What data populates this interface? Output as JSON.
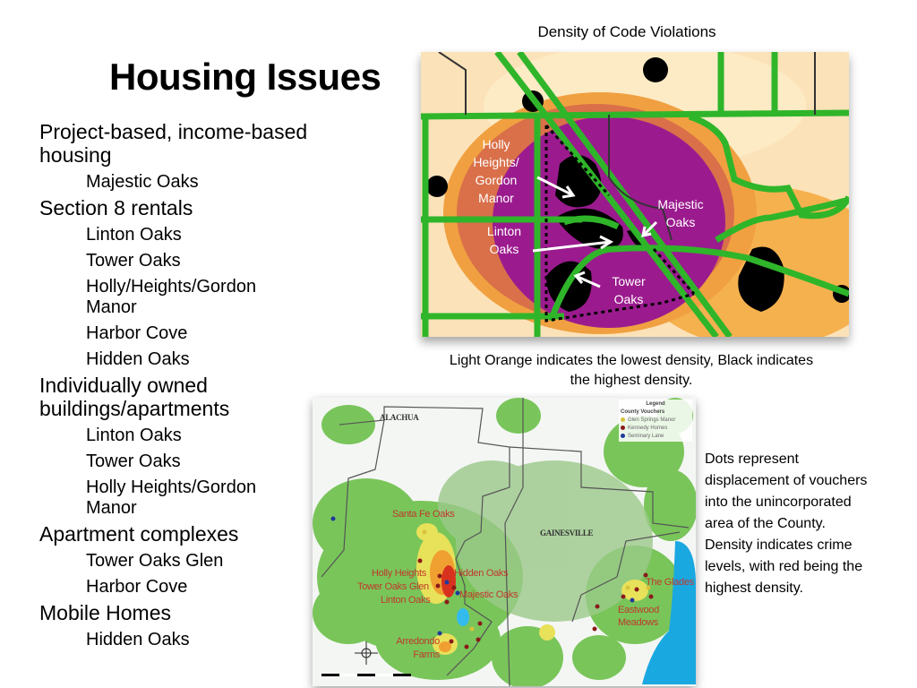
{
  "slide": {
    "title": "Housing Issues",
    "outline": [
      {
        "heading": "Project-based, income-based housing",
        "items": [
          "Majestic Oaks"
        ]
      },
      {
        "heading": "Section 8 rentals",
        "items": [
          "Linton Oaks",
          "Tower Oaks",
          "Holly/Heights/Gordon Manor",
          "Harbor Cove",
          "Hidden Oaks"
        ]
      },
      {
        "heading": "Individually owned buildings/apartments",
        "items": [
          "Linton Oaks",
          "Tower Oaks",
          "Holly Heights/Gordon Manor"
        ]
      },
      {
        "heading": "Apartment complexes",
        "items": [
          "Tower Oaks Glen",
          "Harbor Cove"
        ]
      },
      {
        "heading": "Mobile Homes",
        "items": [
          "Hidden Oaks"
        ]
      }
    ]
  },
  "map_code_violations": {
    "caption_title": "Density of Code Violations",
    "caption_note": "Light Orange indicates the lowest density, Black indicates the highest density.",
    "labels": {
      "holly": "Holly Heights/ Gordon Manor",
      "majestic": "Majestic Oaks",
      "linton": "Linton Oaks",
      "tower": "Tower Oaks"
    },
    "colors": {
      "low": "#fbd9a0",
      "mid": "#f4a742",
      "high": "#9b1b8e",
      "highest": "#000000",
      "roads": "#2fb52a"
    }
  },
  "map_vouchers": {
    "place_labels": {
      "alachua": "ALACHUA",
      "gainesville": "GAINESVILLE"
    },
    "site_labels": {
      "santa_fe": "Santa Fe Oaks",
      "holly": "Holly Heights",
      "hidden": "Hidden Oaks",
      "tower_glen": "Tower Oaks Glen",
      "majestic": "Majestic Oaks",
      "linton": "Linton Oaks",
      "arredondo": "Arredondo Farms",
      "glades": "The Glades",
      "eastwood": "Eastwood Meadows"
    },
    "legend": {
      "title": "Legend",
      "subtitle": "County Vouchers",
      "entries": [
        {
          "label": "Glen Springs Manor",
          "color": "#d8c23a"
        },
        {
          "label": "Kennedy Homes",
          "color": "#8b1a1a"
        },
        {
          "label": "Seminary Lane",
          "color": "#1f3a9a"
        }
      ]
    },
    "description": "Dots represent displacement of vouchers into the unincorporated area of the County. Density indicates crime levels, with red being the highest density."
  }
}
